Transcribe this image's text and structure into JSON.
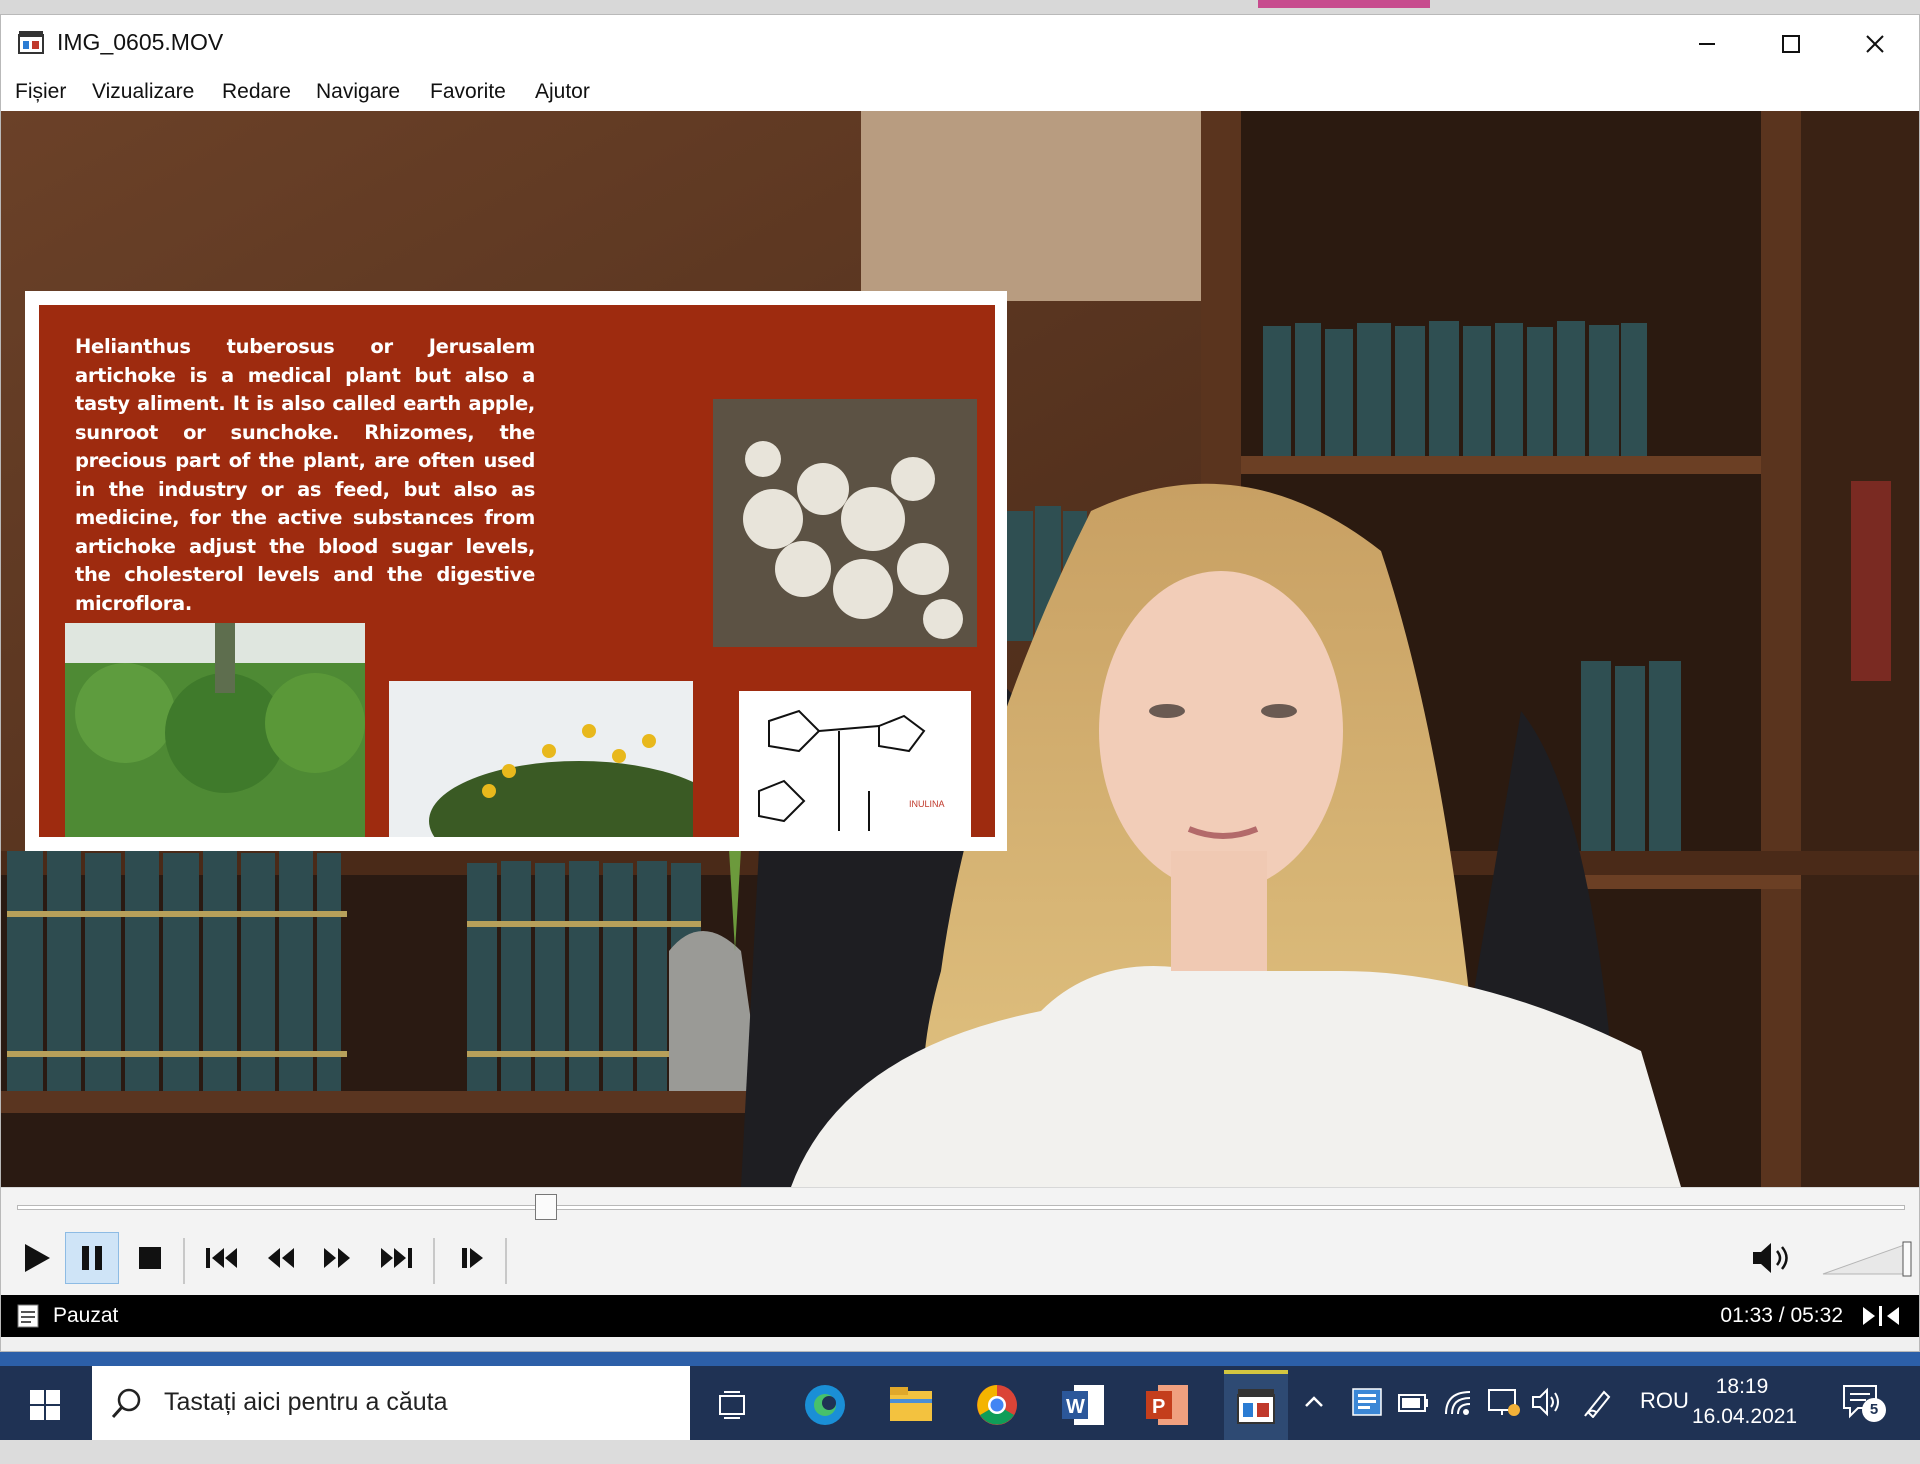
{
  "window": {
    "title": "IMG_0605.MOV",
    "menu": [
      "Fișier",
      "Vizualizare",
      "Redare",
      "Navigare",
      "Favorite",
      "Ajutor"
    ]
  },
  "slide": {
    "text": "Helianthus tuberosus or Jerusalem artichoke is a medical plant but also a tasty aliment. It is also called earth apple, sunroot or sunchoke. Rhizomes, the precious part of the plant, are often used in the industry or as feed, but also as  medicine, for the active substances from artichoke adjust the blood sugar levels, the cholesterol levels and the digestive microflora.",
    "chemical_caption": "INULINA"
  },
  "controls": {
    "seek_position": 0.28,
    "volume_level": 1.0,
    "buttons": [
      "play-icon",
      "pause-icon",
      "stop-icon",
      "skip-back-icon",
      "rewind-icon",
      "fast-forward-icon",
      "skip-forward-icon",
      "step-frame-icon",
      "volume-icon"
    ]
  },
  "status": {
    "state": "Pauzat",
    "time": "01:33 / 05:32"
  },
  "taskbar": {
    "search_placeholder": "Tastați aici pentru a căuta",
    "language": "ROU",
    "clock_time": "18:19",
    "clock_date": "16.04.2021",
    "notification_count": "5"
  },
  "colors": {
    "slide_background": "#9e2b0f",
    "taskbar": "#1f3254",
    "status_bar": "#000000"
  }
}
